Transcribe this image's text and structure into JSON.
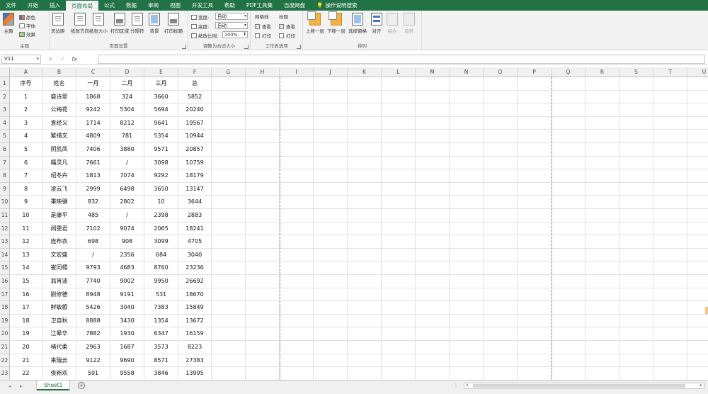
{
  "menu": {
    "tabs": [
      "文件",
      "开始",
      "插入",
      "页面布局",
      "公式",
      "数据",
      "审阅",
      "视图",
      "开发工具",
      "帮助",
      "PDF工具集",
      "百度网盘",
      "操作说明搜索"
    ],
    "active_tab": "页面布局",
    "accent": "#217346"
  },
  "ribbon": {
    "theme_group": {
      "label": "主题",
      "theme_button": "主题",
      "colors": "颜色",
      "fonts": "字体",
      "effects": "效果"
    },
    "page_setup_group": {
      "label": "页面设置",
      "buttons": [
        "页边距",
        "纸张方向",
        "纸张大小",
        "打印区域",
        "分隔符",
        "背景",
        "打印标题"
      ]
    },
    "scale_group": {
      "label": "调整为合适大小",
      "width_label": "宽度:",
      "width_value": "自动",
      "height_label": "高度:",
      "height_value": "自动",
      "scale_label": "缩放比例:",
      "scale_value": "100%"
    },
    "sheet_options_group": {
      "label": "工作表选项",
      "gridlines_title": "网格线",
      "headings_title": "标题",
      "view_label": "查看",
      "print_label": "打印",
      "check_mark": "✓"
    },
    "arrange_group": {
      "label": "排列",
      "buttons": [
        "上移一层",
        "下移一层",
        "选择窗格",
        "对齐",
        "组合",
        "旋转"
      ]
    }
  },
  "formula_bar": {
    "name_box": "V11",
    "cancel_icon": "✕",
    "enter_icon": "✓",
    "fx_label": "fx",
    "formula": ""
  },
  "sheet": {
    "columns": [
      "A",
      "B",
      "C",
      "D",
      "E",
      "F",
      "G",
      "H",
      "I",
      "J",
      "K",
      "L",
      "M",
      "N",
      "O",
      "P",
      "Q",
      "R",
      "S",
      "T",
      "U"
    ],
    "row_numbers": [
      "1",
      "2",
      "3",
      "4",
      "5",
      "6",
      "7",
      "8",
      "9",
      "10",
      "11",
      "12",
      "13",
      "14",
      "15",
      "16",
      "17",
      "18",
      "19",
      "20",
      "21",
      "22",
      "23"
    ],
    "rows": [
      [
        "序号",
        "姓名",
        "一月",
        "二月",
        "三月",
        "总"
      ],
      [
        "1",
        "盛诗翠",
        "1868",
        "324",
        "3660",
        "5852"
      ],
      [
        "2",
        "公梅花",
        "9242",
        "5304",
        "5694",
        "20240"
      ],
      [
        "3",
        "袁经义",
        "1714",
        "8212",
        "9641",
        "19567"
      ],
      [
        "4",
        "繁措文",
        "4809",
        "781",
        "5354",
        "10944"
      ],
      [
        "5",
        "阴凯凤",
        "7406",
        "3880",
        "9571",
        "20857"
      ],
      [
        "6",
        "糯灵凡",
        "7661",
        "/",
        "3098",
        "10759"
      ],
      [
        "7",
        "绍冬卉",
        "1813",
        "7074",
        "9292",
        "18179"
      ],
      [
        "8",
        "凌云飞",
        "2999",
        "6498",
        "3650",
        "13147"
      ],
      [
        "9",
        "秉映骥",
        "832",
        "2802",
        "10",
        "3644"
      ],
      [
        "10",
        "是康平",
        "485",
        "/",
        "2398",
        "2883"
      ],
      [
        "11",
        "阊雯君",
        "7102",
        "9074",
        "2065",
        "18241"
      ],
      [
        "12",
        "庞布衣",
        "698",
        "908",
        "3099",
        "4705"
      ],
      [
        "13",
        "文宏盛",
        "/",
        "2356",
        "684",
        "3040"
      ],
      [
        "14",
        "崔同樗",
        "9793",
        "4683",
        "8760",
        "23236"
      ],
      [
        "15",
        "翁宵波",
        "7740",
        "9002",
        "9950",
        "26692"
      ],
      [
        "16",
        "尉修德",
        "8948",
        "9191",
        "531",
        "18670"
      ],
      [
        "17",
        "鲜敏叡",
        "5426",
        "3040",
        "7383",
        "15849"
      ],
      [
        "18",
        "卫自秋",
        "8888",
        "3430",
        "1354",
        "13672"
      ],
      [
        "19",
        "江晕华",
        "7882",
        "1930",
        "6347",
        "16159"
      ],
      [
        "20",
        "楮代柔",
        "2963",
        "1687",
        "3573",
        "8223"
      ],
      [
        "21",
        "来瑞云",
        "9122",
        "9690",
        "8571",
        "27383"
      ],
      [
        "22",
        "俟新欢",
        "591",
        "9558",
        "3846",
        "13995"
      ]
    ]
  },
  "bottom": {
    "sheet_tab": "Sheet1",
    "add_sheet": "+",
    "nav_prev": "◂",
    "nav_next": "▸"
  }
}
